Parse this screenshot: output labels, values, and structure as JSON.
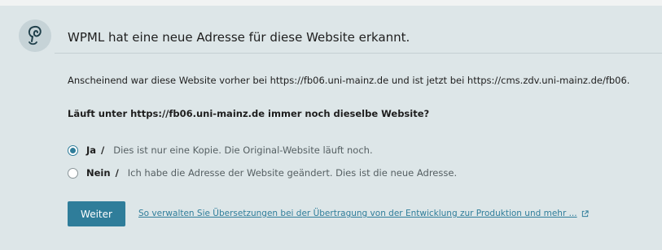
{
  "notice": {
    "title": "WPML hat eine neue Adresse für diese Website erkannt.",
    "description": "Anscheinend war diese Website vorher bei https://fb06.uni-mainz.de und ist jetzt bei https://cms.zdv.uni-mainz.de/fb06.",
    "question": "Läuft unter https://fb06.uni-mainz.de immer noch dieselbe Website?",
    "options": [
      {
        "label": "Ja",
        "separator": "/",
        "description": "Dies ist nur eine Kopie. Die Original-Website läuft noch.",
        "checked": true
      },
      {
        "label": "Nein",
        "separator": "/",
        "description": "Ich habe die Adresse der Website geändert. Dies ist die neue Adresse.",
        "checked": false
      }
    ],
    "button_label": "Weiter",
    "help_link": "So verwalten Sie Übersetzungen bei der Übertragung von der Entwicklung zur Produktion und mehr ..."
  },
  "icons": {
    "logo": "wpml-logo-icon",
    "external": "external-link-icon"
  },
  "colors": {
    "background": "#dde6e8",
    "accent": "#2f7d9a",
    "logo_circle": "#c6d3d7"
  }
}
